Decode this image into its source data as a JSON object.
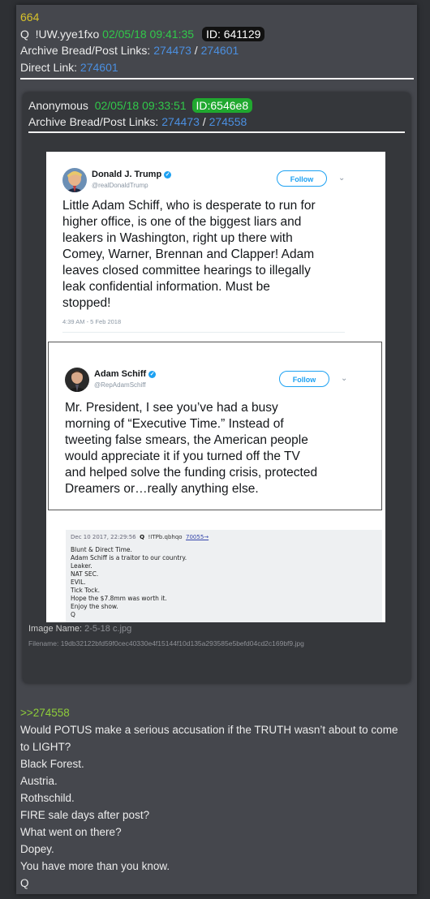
{
  "post": {
    "number": "664",
    "trip_prefix": "Q",
    "tripcode": "!UW.yye1fxo",
    "timestamp": "02/05/18 09:41:35",
    "id": "ID: 641129",
    "archive_label": "Archive Bread/Post Links:",
    "archive_link_1": "274473",
    "separator": "/",
    "archive_link_2": "274601",
    "direct_label": "Direct Link:",
    "direct_link": "274601"
  },
  "nested": {
    "author": "Anonymous",
    "timestamp": "02/05/18 09:33:51",
    "id": "ID:6546e8",
    "archive_label": "Archive Bread/Post Links:",
    "archive_link_1": "274473",
    "separator": "/",
    "archive_link_2": "274558",
    "image_name_label": "Image Name:",
    "image_name": "2-5-18 c.jpg",
    "filename_label": "Filename:",
    "filename": "19db32122bfd59f0cec40330e4f15144f10d135a293585e5befd04cd2c169bf9.jpg"
  },
  "screenshot": {
    "tweet1": {
      "name": "Donald J. Trump",
      "handle": "@realDonaldTrump",
      "follow": "Follow",
      "lines": [
        "Little Adam Schiff, who is desperate to run for",
        "higher office, is one of the biggest liars and",
        "leakers in Washington, right up there with",
        "Comey, Warner, Brennan and Clapper! Adam",
        "leaves closed committee hearings to illegally",
        "leak confidential information. Must be",
        "stopped!"
      ],
      "time": "4:39 AM - 5 Feb 2018"
    },
    "tweet2": {
      "name": "Adam Schiff",
      "handle": "@RepAdamSchiff",
      "follow": "Follow",
      "lines": [
        "Mr. President, I see you’ve had a busy",
        "morning of “Executive Time.” Instead of",
        "tweeting false smears, the American people",
        "would appreciate it if you turned off the TV",
        "and helped solve the funding crisis, protected",
        "Dreamers or…really anything else."
      ]
    },
    "old_post": {
      "date": "Dec 10 2017, 22:29:56",
      "q": "Q",
      "trip": "!ITPb.qbhqo",
      "link": "70055→",
      "lines": [
        "Blunt & Direct Time.",
        "Adam Schiff is a traitor to our country.",
        "Leaker.",
        "NAT SEC.",
        "EVIL.",
        "Tick Tock.",
        "Hope the $7.8mm was worth it.",
        "Enjoy the show.",
        "Q"
      ]
    }
  },
  "message": {
    "quote_link": ">>274558",
    "lines": [
      "Would POTUS make a serious accusation if the TRUTH wasn’t about to come",
      "to LIGHT?",
      "Black Forest.",
      "Austria.",
      "Rothschild.",
      "FIRE sale days after post?",
      "What went on there?",
      "Dopey.",
      "You have more than you know.",
      "Q"
    ]
  }
}
